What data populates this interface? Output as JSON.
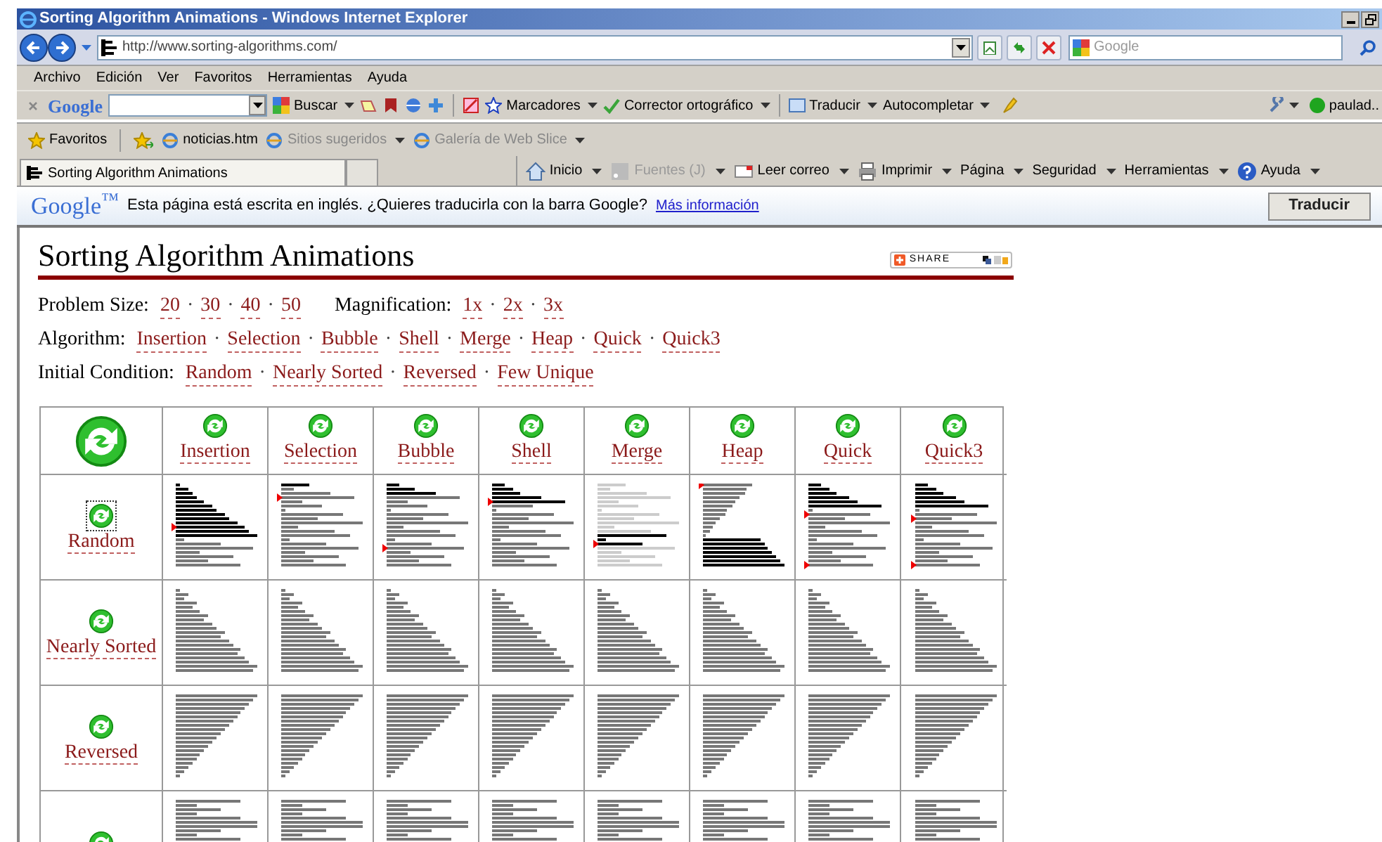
{
  "window": {
    "title": "Sorting Algorithm Animations - Windows Internet Explorer"
  },
  "address_bar": {
    "url": "http://www.sorting-algorithms.com/"
  },
  "search_box": {
    "placeholder": "Google"
  },
  "menu": [
    "Archivo",
    "Edición",
    "Ver",
    "Favoritos",
    "Herramientas",
    "Ayuda"
  ],
  "google_toolbar": {
    "logo": "Google",
    "items": [
      {
        "label": "Buscar"
      },
      {
        "label": "Marcadores"
      },
      {
        "label": "Corrector ortográfico"
      },
      {
        "label": "Traducir"
      },
      {
        "label": "Autocompletar"
      }
    ],
    "account": "paulad.."
  },
  "favorites_bar": {
    "favorites": "Favoritos",
    "links": [
      {
        "label": "noticias.htm",
        "disabled": false,
        "dropdown": false
      },
      {
        "label": "Sitios sugeridos",
        "disabled": true,
        "dropdown": true
      },
      {
        "label": "Galería de Web Slice",
        "disabled": true,
        "dropdown": true
      }
    ]
  },
  "tab": {
    "title": "Sorting Algorithm Animations"
  },
  "command_bar": [
    {
      "label": "Inicio",
      "disabled": false
    },
    {
      "label": "Fuentes (J)",
      "disabled": true
    },
    {
      "label": "Leer correo",
      "disabled": false
    },
    {
      "label": "Imprimir",
      "disabled": false
    },
    {
      "label": "Página",
      "disabled": false
    },
    {
      "label": "Seguridad",
      "disabled": false
    },
    {
      "label": "Herramientas",
      "disabled": false
    },
    {
      "label": "Ayuda",
      "disabled": false
    }
  ],
  "translate_bar": {
    "logo": "Google$^{™}$",
    "message": "Esta página está escrita en inglés. ¿Quieres traducirla con la barra Google?",
    "link": "Más información",
    "button": "Traducir"
  },
  "page": {
    "title": "Sorting Algorithm Animations",
    "share": "SHARE",
    "option_lines": [
      {
        "groups": [
          {
            "label": "Problem Size:",
            "links": [
              "20",
              "30",
              "40",
              "50"
            ],
            "separators": [
              "·",
              "·",
              "·"
            ]
          },
          {
            "label": "Magnification:",
            "links": [
              "1x",
              "2x",
              "3x"
            ],
            "separators": [
              "·",
              "·"
            ]
          }
        ]
      },
      {
        "groups": [
          {
            "label": "Algorithm:",
            "links": [
              "Insertion",
              "Selection",
              "Bubble",
              "Shell",
              "Merge",
              "Heap",
              "Quick",
              "Quick3"
            ],
            "separators": [
              "·",
              "·",
              "·",
              "·",
              "·",
              "·",
              "·"
            ]
          }
        ]
      },
      {
        "groups": [
          {
            "label": "Initial Condition:",
            "links": [
              "Random",
              "Nearly Sorted",
              "Reversed",
              "Few Unique"
            ],
            "separators": [
              "·",
              "·",
              "·"
            ]
          }
        ]
      }
    ]
  },
  "table": {
    "columns": [
      {
        "label": "Insertion"
      },
      {
        "label": "Selection"
      },
      {
        "label": "Bubble"
      },
      {
        "label": "Shell"
      },
      {
        "label": "Merge"
      },
      {
        "label": "Heap"
      },
      {
        "label": "Quick"
      },
      {
        "label": "Quick3"
      }
    ],
    "rows": [
      {
        "label": "Random",
        "kind": "random",
        "focused": true
      },
      {
        "label": "Nearly Sorted",
        "kind": "nearly_sorted",
        "focused": false
      },
      {
        "label": "Reversed",
        "kind": "reversed",
        "focused": false
      },
      {
        "kind": "few_unique"
      }
    ]
  }
}
